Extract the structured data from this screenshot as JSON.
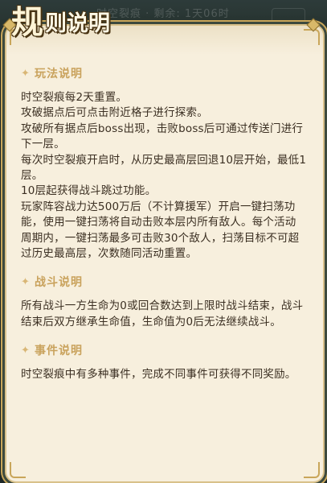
{
  "background": {
    "ghost_text": "时空裂痕 · 剩余: 1天06时"
  },
  "title": {
    "first_char": "规",
    "rest": "则说明"
  },
  "sections": [
    {
      "heading": "玩法说明",
      "lines": [
        "时空裂痕每2天重置。",
        "攻破据点后可点击附近格子进行探索。",
        "攻破所有据点后boss出现，击败boss后可通过传送门进行下一层。",
        "每次时空裂痕开启时，从历史最高层回退10层开始，最低1层。",
        "10层起获得战斗跳过功能。",
        "玩家阵容战力达500万后（不计算援军）开启一键扫荡功能，使用一键扫荡将自动击败本层内所有敌人。每个活动周期内，一键扫荡最多可击败30个敌人，扫荡目标不可超过历史最高层，次数随同活动重置。"
      ]
    },
    {
      "heading": "战斗说明",
      "lines": [
        "所有战斗一方生命为0或回合数达到上限时战斗结束，战斗结束后双方继承生命值，生命值为0后无法继续战斗。"
      ]
    },
    {
      "heading": "事件说明",
      "lines": [
        "时空裂痕中有多种事件，完成不同事件可获得不同奖励。"
      ]
    }
  ],
  "icons": {
    "section": "sparkle-icon"
  },
  "colors": {
    "panel": "#f7efdd",
    "heading": "#c9a25c",
    "body_text": "#3b2f22",
    "border_gold": "#c9a65a"
  }
}
